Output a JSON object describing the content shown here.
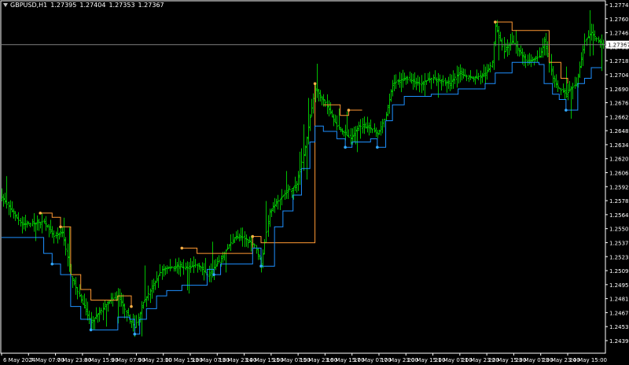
{
  "header": {
    "symbol_tf": "GBPUSD,H1",
    "open": "1.27395",
    "high": "1.27404",
    "low": "1.27353",
    "close": "1.27367"
  },
  "current_price": "1.27367",
  "colors": {
    "background": "#000000",
    "frame": "#ffffff",
    "bars": "#00c000",
    "upper_line": "#ff9933",
    "lower_line": "#1e90ff",
    "upper_dot": "#ffb347",
    "lower_dot": "#33aaff",
    "price_line": "#808080",
    "axis_text": "#ffffff",
    "price_tag_bg": "#ffffff",
    "price_tag_text": "#000000"
  },
  "chart_data": {
    "type": "ohlc",
    "ylim": [
      1.2446,
      1.2778
    ],
    "y_ticks": [
      "1.27745",
      "1.27605",
      "1.27465",
      "1.27325",
      "1.27185",
      "1.27045",
      "1.26905",
      "1.26765",
      "1.26625",
      "1.26485",
      "1.26345",
      "1.26205",
      "1.26065",
      "1.25925",
      "1.25785",
      "1.25645",
      "1.25505",
      "1.25370",
      "1.25230",
      "1.25090",
      "1.24950",
      "1.24810",
      "1.24670",
      "1.24530",
      "1.24390"
    ],
    "x_ticks": [
      "6 May 2024",
      "7 May 07:00",
      "7 May 23:00",
      "8 May 15:00",
      "9 May 07:00",
      "9 May 23:00",
      "10 May 15:00",
      "13 May 07:00",
      "13 May 23:00",
      "14 May 15:00",
      "15 May 07:00",
      "15 May 23:00",
      "16 May 15:00",
      "17 May 07:00",
      "17 May 23:00",
      "20 May 15:00",
      "21 May 07:00",
      "21 May 23:00",
      "22 May 15:00",
      "23 May 07:00",
      "23 May 23:00",
      "24 May 15:00"
    ],
    "close_path": [
      [
        "6 May 2024 00:00",
        1.2593
      ],
      [
        "6 May 2024 12:00",
        1.2567
      ],
      [
        "7 May 01:00",
        1.257
      ],
      [
        "7 May 07:00",
        1.2556
      ],
      [
        "7 May 12:00",
        1.256
      ],
      [
        "7 May 17:00",
        1.252
      ],
      [
        "7 May 23:00",
        1.2496
      ],
      [
        "8 May 05:00",
        1.2475
      ],
      [
        "8 May 15:00",
        1.2494
      ],
      [
        "8 May 21:00",
        1.25
      ],
      [
        "9 May 04:00",
        1.2478
      ],
      [
        "9 May 07:00",
        1.247
      ],
      [
        "9 May 12:00",
        1.2494
      ],
      [
        "9 May 18:00",
        1.251
      ],
      [
        "9 May 23:00",
        1.2525
      ],
      [
        "10 May 08:00",
        1.2528
      ],
      [
        "10 May 15:00",
        1.2526
      ],
      [
        "10 May 20:00",
        1.253
      ],
      [
        "13 May 02:00",
        1.252
      ],
      [
        "13 May 07:00",
        1.2528
      ],
      [
        "13 May 12:00",
        1.254
      ],
      [
        "13 May 18:00",
        1.2555
      ],
      [
        "13 May 23:00",
        1.2555
      ],
      [
        "14 May 06:00",
        1.2548
      ],
      [
        "14 May 10:00",
        1.253
      ],
      [
        "14 May 15:00",
        1.258
      ],
      [
        "14 May 23:00",
        1.2595
      ],
      [
        "15 May 07:00",
        1.2605
      ],
      [
        "15 May 12:00",
        1.264
      ],
      [
        "15 May 15:00",
        1.2668
      ],
      [
        "15 May 18:00",
        1.2695
      ],
      [
        "15 May 23:00",
        1.2685
      ],
      [
        "16 May 07:00",
        1.266
      ],
      [
        "16 May 15:00",
        1.2648
      ],
      [
        "16 May 20:00",
        1.266
      ],
      [
        "17 May 03:00",
        1.2658
      ],
      [
        "17 May 07:00",
        1.2652
      ],
      [
        "17 May 12:00",
        1.267
      ],
      [
        "17 May 16:00",
        1.27
      ],
      [
        "17 May 23:00",
        1.2705
      ],
      [
        "20 May 08:00",
        1.27
      ],
      [
        "20 May 15:00",
        1.2705
      ],
      [
        "21 May 02:00",
        1.27
      ],
      [
        "21 May 07:00",
        1.271
      ],
      [
        "21 May 15:00",
        1.2705
      ],
      [
        "21 May 23:00",
        1.2708
      ],
      [
        "22 May 03:00",
        1.272
      ],
      [
        "22 May 05:00",
        1.2755
      ],
      [
        "22 May 10:00",
        1.273
      ],
      [
        "22 May 15:00",
        1.274
      ],
      [
        "23 May 00:00",
        1.272
      ],
      [
        "23 May 07:00",
        1.2725
      ],
      [
        "23 May 10:00",
        1.274
      ],
      [
        "23 May 15:00",
        1.2705
      ],
      [
        "23 May 19:00",
        1.2695
      ],
      [
        "23 May 23:00",
        1.269
      ],
      [
        "24 May 05:00",
        1.27
      ],
      [
        "24 May 10:00",
        1.274
      ],
      [
        "24 May 14:00",
        1.2748
      ],
      [
        "24 May 20:00",
        1.27367
      ]
    ],
    "upper_line": [
      [
        "6 May 23:00",
        1.2578
      ],
      [
        "7 May 06:00",
        1.2574
      ],
      [
        "7 May 11:00",
        1.2565
      ],
      [
        "7 May 17:00",
        1.252
      ],
      [
        "7 May 23:00",
        1.2506
      ],
      [
        "8 May 05:00",
        1.2496
      ],
      [
        "8 May 21:00",
        1.25
      ],
      [
        "9 May 05:00",
        1.249
      ],
      [
        "10 May 11:00",
        1.2545
      ],
      [
        "10 May 20:00",
        1.254
      ],
      [
        "13 May 05:00",
        1.254
      ],
      [
        "14 May 05:00",
        1.2556
      ],
      [
        "14 May 10:00",
        1.255
      ],
      [
        "15 May 18:00",
        1.27
      ],
      [
        "15 May 23:00",
        1.268
      ],
      [
        "16 May 09:00",
        1.267
      ],
      [
        "16 May 14:00",
        1.2675
      ],
      [
        "16 May 22:00",
        1.2675
      ],
      [
        "22 May 05:00",
        1.2758
      ],
      [
        "22 May 15:00",
        1.275
      ],
      [
        "23 May 10:00",
        1.275
      ],
      [
        "23 May 13:00",
        1.272
      ],
      [
        "23 May 20:00",
        1.2705
      ],
      [
        "24 May 00:00",
        1.27
      ]
    ],
    "lower_line": [
      [
        "6 May 2024 00:00",
        1.2555
      ],
      [
        "6 May 2024 12:00",
        1.2555
      ],
      [
        "7 May 01:00",
        1.254
      ],
      [
        "7 May 06:00",
        1.253
      ],
      [
        "7 May 11:00",
        1.252
      ],
      [
        "7 May 17:00",
        1.249
      ],
      [
        "7 May 23:00",
        1.2478
      ],
      [
        "8 May 05:00",
        1.2468
      ],
      [
        "8 May 21:00",
        1.248
      ],
      [
        "9 May 04:00",
        1.2478
      ],
      [
        "9 May 07:00",
        1.2464
      ],
      [
        "9 May 10:00",
        1.2478
      ],
      [
        "9 May 14:00",
        1.2488
      ],
      [
        "9 May 20:00",
        1.25
      ],
      [
        "10 May 02:00",
        1.2505
      ],
      [
        "10 May 11:00",
        1.251
      ],
      [
        "13 May 02:00",
        1.2525
      ],
      [
        "13 May 06:00",
        1.252
      ],
      [
        "13 May 10:00",
        1.253
      ],
      [
        "14 May 05:00",
        1.2545
      ],
      [
        "14 May 10:00",
        1.2528
      ],
      [
        "14 May 18:00",
        1.2565
      ],
      [
        "14 May 23:00",
        1.258
      ],
      [
        "15 May 05:00",
        1.2595
      ],
      [
        "15 May 10:00",
        1.262
      ],
      [
        "15 May 15:00",
        1.2645
      ],
      [
        "15 May 18:00",
        1.266
      ],
      [
        "15 May 23:00",
        1.2655
      ],
      [
        "16 May 07:00",
        1.2648
      ],
      [
        "16 May 12:00",
        1.264
      ],
      [
        "16 May 16:00",
        1.2645
      ],
      [
        "17 May 03:00",
        1.2648
      ],
      [
        "17 May 07:00",
        1.264
      ],
      [
        "17 May 12:00",
        1.2665
      ],
      [
        "17 May 16:00",
        1.268
      ],
      [
        "17 May 23:00",
        1.2688
      ],
      [
        "20 May 15:00",
        1.269
      ],
      [
        "21 May 07:00",
        1.2695
      ],
      [
        "21 May 23:00",
        1.27
      ],
      [
        "22 May 05:00",
        1.271
      ],
      [
        "22 May 15:00",
        1.272
      ],
      [
        "23 May 07:00",
        1.2718
      ],
      [
        "23 May 10:00",
        1.27
      ],
      [
        "23 May 15:00",
        1.269
      ],
      [
        "23 May 19:00",
        1.2685
      ],
      [
        "23 May 23:00",
        1.2675
      ],
      [
        "24 May 06:00",
        1.27
      ],
      [
        "24 May 10:00",
        1.2705
      ],
      [
        "24 May 14:00",
        1.2715
      ],
      [
        "24 May 20:00",
        1.2715
      ]
    ],
    "upper_dots": [
      [
        "6 May 23:00",
        1.2578
      ],
      [
        "7 May 11:00",
        1.2565
      ],
      [
        "9 May 05:00",
        1.249
      ],
      [
        "10 May 11:00",
        1.2545
      ],
      [
        "14 May 05:00",
        1.2556
      ],
      [
        "15 May 18:00",
        1.27
      ],
      [
        "16 May 14:00",
        1.2675
      ],
      [
        "22 May 05:00",
        1.2758
      ]
    ],
    "lower_dots": [
      [
        "7 May 06:00",
        1.253
      ],
      [
        "8 May 05:00",
        1.2468
      ],
      [
        "9 May 07:00",
        1.2464
      ],
      [
        "13 May 06:00",
        1.252
      ],
      [
        "14 May 10:00",
        1.2528
      ],
      [
        "16 May 12:00",
        1.264
      ],
      [
        "17 May 07:00",
        1.264
      ],
      [
        "23 May 23:00",
        1.2675
      ]
    ]
  }
}
